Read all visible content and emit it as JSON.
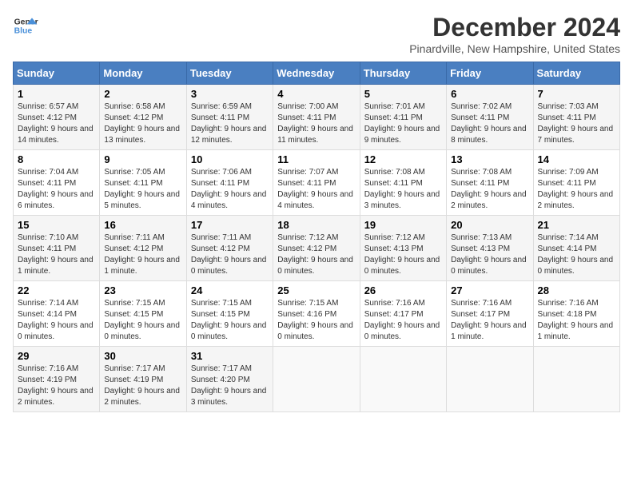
{
  "logo": {
    "line1": "General",
    "line2": "Blue"
  },
  "title": "December 2024",
  "subtitle": "Pinardville, New Hampshire, United States",
  "days_of_week": [
    "Sunday",
    "Monday",
    "Tuesday",
    "Wednesday",
    "Thursday",
    "Friday",
    "Saturday"
  ],
  "weeks": [
    [
      {
        "day": "1",
        "sunrise": "6:57 AM",
        "sunset": "4:12 PM",
        "daylight": "9 hours and 14 minutes."
      },
      {
        "day": "2",
        "sunrise": "6:58 AM",
        "sunset": "4:12 PM",
        "daylight": "9 hours and 13 minutes."
      },
      {
        "day": "3",
        "sunrise": "6:59 AM",
        "sunset": "4:11 PM",
        "daylight": "9 hours and 12 minutes."
      },
      {
        "day": "4",
        "sunrise": "7:00 AM",
        "sunset": "4:11 PM",
        "daylight": "9 hours and 11 minutes."
      },
      {
        "day": "5",
        "sunrise": "7:01 AM",
        "sunset": "4:11 PM",
        "daylight": "9 hours and 9 minutes."
      },
      {
        "day": "6",
        "sunrise": "7:02 AM",
        "sunset": "4:11 PM",
        "daylight": "9 hours and 8 minutes."
      },
      {
        "day": "7",
        "sunrise": "7:03 AM",
        "sunset": "4:11 PM",
        "daylight": "9 hours and 7 minutes."
      }
    ],
    [
      {
        "day": "8",
        "sunrise": "7:04 AM",
        "sunset": "4:11 PM",
        "daylight": "9 hours and 6 minutes."
      },
      {
        "day": "9",
        "sunrise": "7:05 AM",
        "sunset": "4:11 PM",
        "daylight": "9 hours and 5 minutes."
      },
      {
        "day": "10",
        "sunrise": "7:06 AM",
        "sunset": "4:11 PM",
        "daylight": "9 hours and 4 minutes."
      },
      {
        "day": "11",
        "sunrise": "7:07 AM",
        "sunset": "4:11 PM",
        "daylight": "9 hours and 4 minutes."
      },
      {
        "day": "12",
        "sunrise": "7:08 AM",
        "sunset": "4:11 PM",
        "daylight": "9 hours and 3 minutes."
      },
      {
        "day": "13",
        "sunrise": "7:08 AM",
        "sunset": "4:11 PM",
        "daylight": "9 hours and 2 minutes."
      },
      {
        "day": "14",
        "sunrise": "7:09 AM",
        "sunset": "4:11 PM",
        "daylight": "9 hours and 2 minutes."
      }
    ],
    [
      {
        "day": "15",
        "sunrise": "7:10 AM",
        "sunset": "4:11 PM",
        "daylight": "9 hours and 1 minute."
      },
      {
        "day": "16",
        "sunrise": "7:11 AM",
        "sunset": "4:12 PM",
        "daylight": "9 hours and 1 minute."
      },
      {
        "day": "17",
        "sunrise": "7:11 AM",
        "sunset": "4:12 PM",
        "daylight": "9 hours and 0 minutes."
      },
      {
        "day": "18",
        "sunrise": "7:12 AM",
        "sunset": "4:12 PM",
        "daylight": "9 hours and 0 minutes."
      },
      {
        "day": "19",
        "sunrise": "7:12 AM",
        "sunset": "4:13 PM",
        "daylight": "9 hours and 0 minutes."
      },
      {
        "day": "20",
        "sunrise": "7:13 AM",
        "sunset": "4:13 PM",
        "daylight": "9 hours and 0 minutes."
      },
      {
        "day": "21",
        "sunrise": "7:14 AM",
        "sunset": "4:14 PM",
        "daylight": "9 hours and 0 minutes."
      }
    ],
    [
      {
        "day": "22",
        "sunrise": "7:14 AM",
        "sunset": "4:14 PM",
        "daylight": "9 hours and 0 minutes."
      },
      {
        "day": "23",
        "sunrise": "7:15 AM",
        "sunset": "4:15 PM",
        "daylight": "9 hours and 0 minutes."
      },
      {
        "day": "24",
        "sunrise": "7:15 AM",
        "sunset": "4:15 PM",
        "daylight": "9 hours and 0 minutes."
      },
      {
        "day": "25",
        "sunrise": "7:15 AM",
        "sunset": "4:16 PM",
        "daylight": "9 hours and 0 minutes."
      },
      {
        "day": "26",
        "sunrise": "7:16 AM",
        "sunset": "4:17 PM",
        "daylight": "9 hours and 0 minutes."
      },
      {
        "day": "27",
        "sunrise": "7:16 AM",
        "sunset": "4:17 PM",
        "daylight": "9 hours and 1 minute."
      },
      {
        "day": "28",
        "sunrise": "7:16 AM",
        "sunset": "4:18 PM",
        "daylight": "9 hours and 1 minute."
      }
    ],
    [
      {
        "day": "29",
        "sunrise": "7:16 AM",
        "sunset": "4:19 PM",
        "daylight": "9 hours and 2 minutes."
      },
      {
        "day": "30",
        "sunrise": "7:17 AM",
        "sunset": "4:19 PM",
        "daylight": "9 hours and 2 minutes."
      },
      {
        "day": "31",
        "sunrise": "7:17 AM",
        "sunset": "4:20 PM",
        "daylight": "9 hours and 3 minutes."
      },
      null,
      null,
      null,
      null
    ]
  ]
}
